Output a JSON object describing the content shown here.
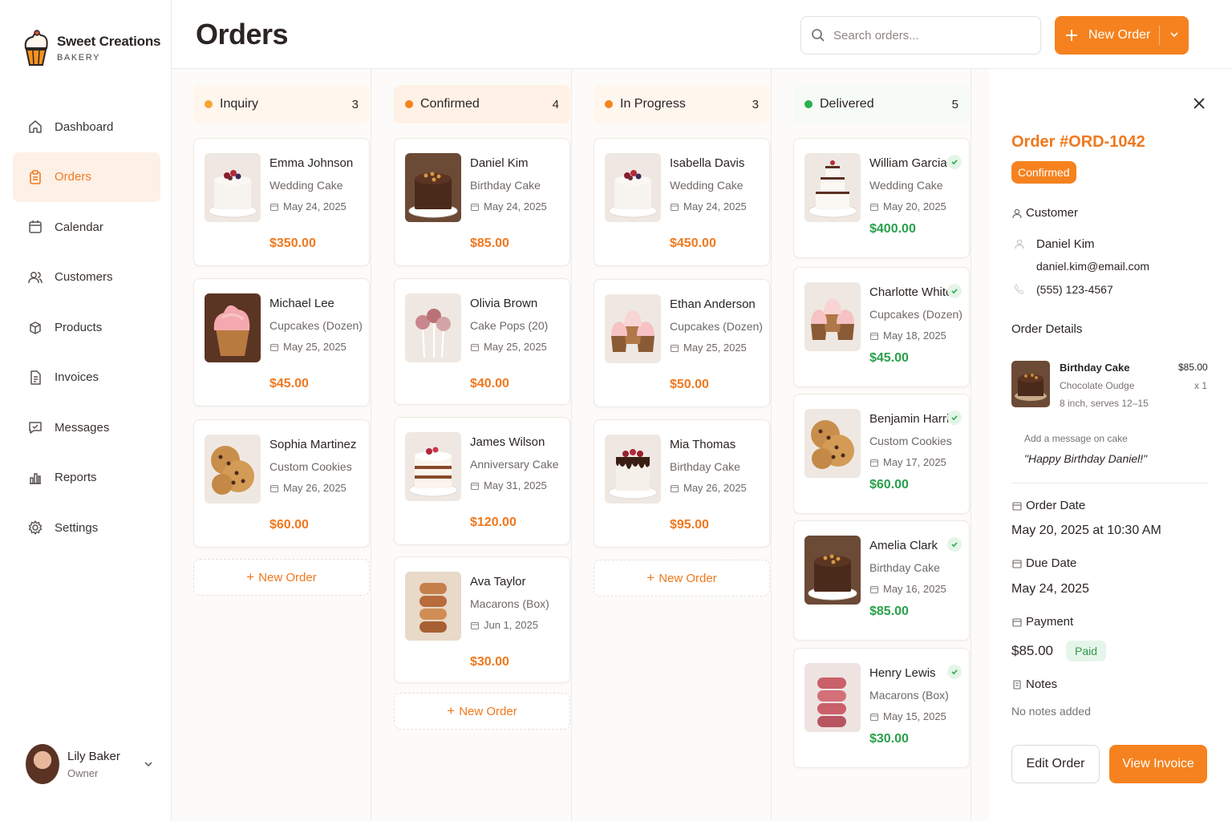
{
  "brand": {
    "name": "Sweet Creations",
    "subtitle": "BAKERY"
  },
  "nav": [
    {
      "label": "Dashboard",
      "icon": "home-icon"
    },
    {
      "label": "Orders",
      "icon": "clipboard-icon",
      "active": true
    },
    {
      "label": "Calendar",
      "icon": "calendar-icon"
    },
    {
      "label": "Customers",
      "icon": "users-icon"
    },
    {
      "label": "Products",
      "icon": "box-icon"
    },
    {
      "label": "Invoices",
      "icon": "document-icon"
    },
    {
      "label": "Messages",
      "icon": "chat-icon"
    },
    {
      "label": "Reports",
      "icon": "bar-chart-icon"
    },
    {
      "label": "Settings",
      "icon": "gear-icon"
    }
  ],
  "user": {
    "name": "Lily Baker",
    "role": "Owner"
  },
  "header": {
    "title": "Orders",
    "search_placeholder": "Search orders...",
    "new_order_label": "New Order"
  },
  "colors": {
    "accent": "#f5821f",
    "inquiry": "#f7a534",
    "confirmed": "#f3841e",
    "in_progress": "#f3841e",
    "delivered": "#2bb04c",
    "price_green": "#28a04a"
  },
  "columns": [
    {
      "title": "Inquiry",
      "count": "3",
      "cards": [
        {
          "name": "Emma Johnson",
          "product": "Wedding Cake",
          "date": "May 24, 2025",
          "price": "$350.00",
          "thumb": "wedding-cake"
        },
        {
          "name": "Michael Lee",
          "product": "Cupcakes (Dozen)",
          "date": "May 25, 2025",
          "price": "$45.00",
          "thumb": "cupcake"
        },
        {
          "name": "Sophia Martinez",
          "product": "Custom Cookies",
          "date": "May 26, 2025",
          "price": "$60.00",
          "thumb": "cookies"
        }
      ],
      "add_label": "New Order"
    },
    {
      "title": "Confirmed",
      "count": "4",
      "cards": [
        {
          "name": "Daniel Kim",
          "product": "Birthday Cake",
          "date": "May 24, 2025",
          "price": "$85.00",
          "thumb": "chocolate-cake"
        },
        {
          "name": "Olivia Brown",
          "product": "Cake Pops (20)",
          "date": "May 25, 2025",
          "price": "$40.00",
          "thumb": "cake-pops"
        },
        {
          "name": "James Wilson",
          "product": "Anniversary Cake",
          "date": "May 31, 2025",
          "price": "$120.00",
          "thumb": "layer-cake"
        },
        {
          "name": "Ava Taylor",
          "product": "Macarons (Box)",
          "date": "Jun 1, 2025",
          "price": "$30.00",
          "thumb": "macarons-brown"
        }
      ],
      "add_label": "New Order"
    },
    {
      "title": "In Progress",
      "count": "3",
      "cards": [
        {
          "name": "Isabella Davis",
          "product": "Wedding Cake",
          "date": "May 24, 2025",
          "price": "$450.00",
          "thumb": "wedding-cake"
        },
        {
          "name": "Ethan Anderson",
          "product": "Cupcakes (Dozen)",
          "date": "May 25, 2025",
          "price": "$50.00",
          "thumb": "cupcakes-many"
        },
        {
          "name": "Mia Thomas",
          "product": "Birthday Cake",
          "date": "May 26, 2025",
          "price": "$95.00",
          "thumb": "drip-cake"
        }
      ],
      "add_label": "New Order"
    },
    {
      "title": "Delivered",
      "count": "5",
      "cards": [
        {
          "name": "William Garcia",
          "product": "Wedding Cake",
          "date": "May 20, 2025",
          "price": "$400.00",
          "thumb": "tier-cake"
        },
        {
          "name": "Charlotte White",
          "product": "Cupcakes (Dozen)",
          "date": "May 18, 2025",
          "price": "$45.00",
          "thumb": "cupcakes-many"
        },
        {
          "name": "Benjamin Harris",
          "product": "Custom Cookies",
          "date": "May 17, 2025",
          "price": "$60.00",
          "thumb": "cookies"
        },
        {
          "name": "Amelia Clark",
          "product": "Birthday Cake",
          "date": "May 16, 2025",
          "price": "$85.00",
          "thumb": "chocolate-cake"
        },
        {
          "name": "Henry Lewis",
          "product": "Macarons (Box)",
          "date": "May 15, 2025",
          "price": "$30.00",
          "thumb": "macarons-pink"
        }
      ]
    }
  ],
  "detail": {
    "order_id": "Order #ORD-1042",
    "status": "Confirmed",
    "customer_label": "Customer",
    "customer_name": "Daniel Kim",
    "customer_email": "daniel.kim@email.com",
    "customer_phone": "(555) 123-4567",
    "order_details_label": "Order Details",
    "item_name": "Birthday Cake",
    "item_price": "$85.00",
    "item_flavor": "Chocolate Oudge",
    "item_qty": "x 1",
    "item_size": "8 inch, serves 12–15",
    "message_label": "Add a message on cake",
    "message_text": "\"Happy Birthday Daniel!\"",
    "order_date_label": "Order Date",
    "order_date": "May 20, 2025 at 10:30 AM",
    "due_date_label": "Due Date",
    "due_date": "May 24, 2025",
    "payment_label": "Payment",
    "payment_amount": "$85.00",
    "payment_status": "Paid",
    "notes_label": "Notes",
    "notes_text": "No notes added",
    "edit_label": "Edit Order",
    "invoice_label": "View Invoice"
  }
}
